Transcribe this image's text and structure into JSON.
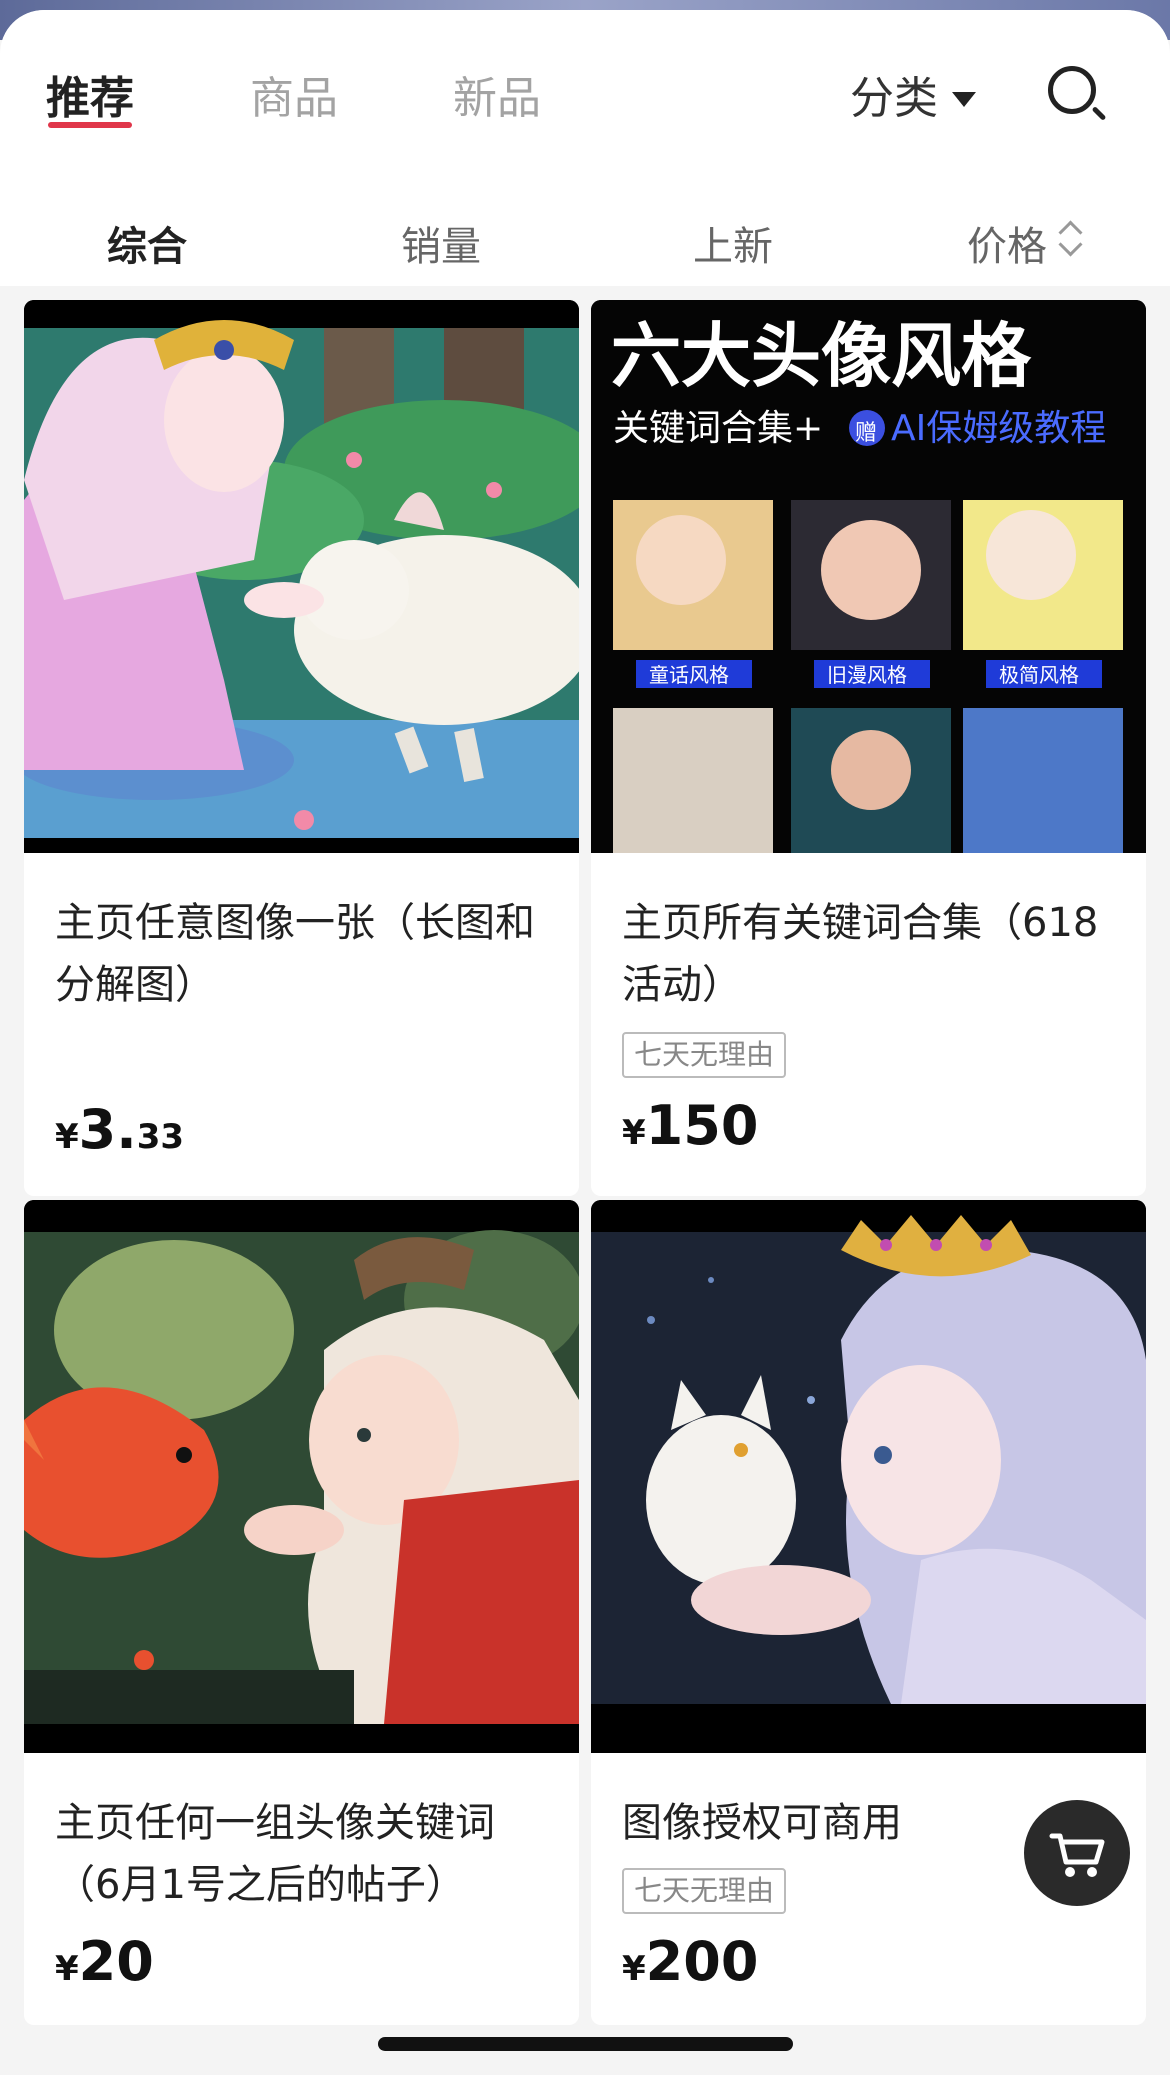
{
  "tabs": {
    "recommend": "推荐",
    "products": "商品",
    "new_products": "新品",
    "category": "分类"
  },
  "sort": {
    "overall": "综合",
    "sales": "销量",
    "newest": "上新",
    "price": "价格"
  },
  "products": [
    {
      "title": "主页任意图像一张（长图和分解图）",
      "badge": "",
      "price_yen": "¥",
      "price_int": "3.",
      "price_dec": "33"
    },
    {
      "title": "主页所有关键词合集（618活动）",
      "badge": "七天无理由",
      "price_yen": "¥",
      "price_int": "150",
      "price_dec": "",
      "image_text": {
        "headline": "六大头像风格",
        "subline_a": "关键词合集+",
        "gift": "赠",
        "subline_b": "AI保姆级教程",
        "styles": [
          "童话风格",
          "旧漫风格",
          "极简风格"
        ]
      }
    },
    {
      "title": "主页任何一组头像关键词（6月1号之后的帖子）",
      "badge": "",
      "price_yen": "¥",
      "price_int": "20",
      "price_dec": ""
    },
    {
      "title": "图像授权可商用",
      "badge": "七天无理由",
      "price_yen": "¥",
      "price_int": "200",
      "price_dec": ""
    }
  ],
  "icons": {
    "search": "search-icon",
    "caret": "caret-down-icon",
    "price_sort": "sort-arrows-icon",
    "cart": "cart-icon"
  },
  "colors": {
    "accent": "#e0364a",
    "headline_blue": "#3b4fe0"
  }
}
